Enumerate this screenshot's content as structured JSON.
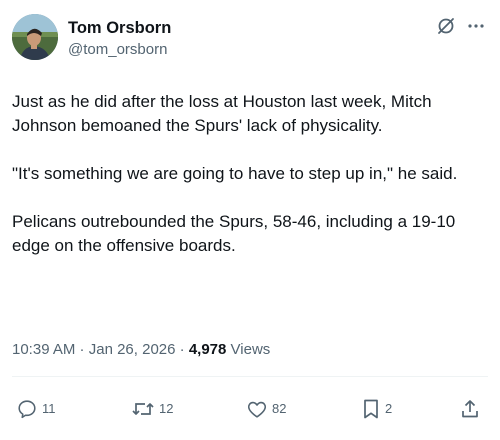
{
  "author": {
    "display_name": "Tom Orsborn",
    "handle": "@tom_orsborn"
  },
  "header_icons": [
    "grok-icon",
    "more-icon"
  ],
  "body": {
    "paragraphs": [
      "Just as he did after the loss at Houston last week, Mitch Johnson bemoaned the Spurs' lack of physicality.",
      "\"It's something we are going to have to step up in,\" he said.",
      "Pelicans outrebounded the Spurs, 58-46, including a 19-10 edge on the offensive boards."
    ]
  },
  "meta": {
    "time": "10:39 AM",
    "separator1": " · ",
    "date": "Jan 26, 2026",
    "separator2": " · ",
    "views_count": "4,978",
    "views_label": " Views"
  },
  "actions": {
    "replies": "11",
    "reposts": "12",
    "likes": "82",
    "bookmarks": "2"
  },
  "colors": {
    "text_primary": "#0f1419",
    "text_secondary": "#536471",
    "divider": "#eff3f4"
  }
}
